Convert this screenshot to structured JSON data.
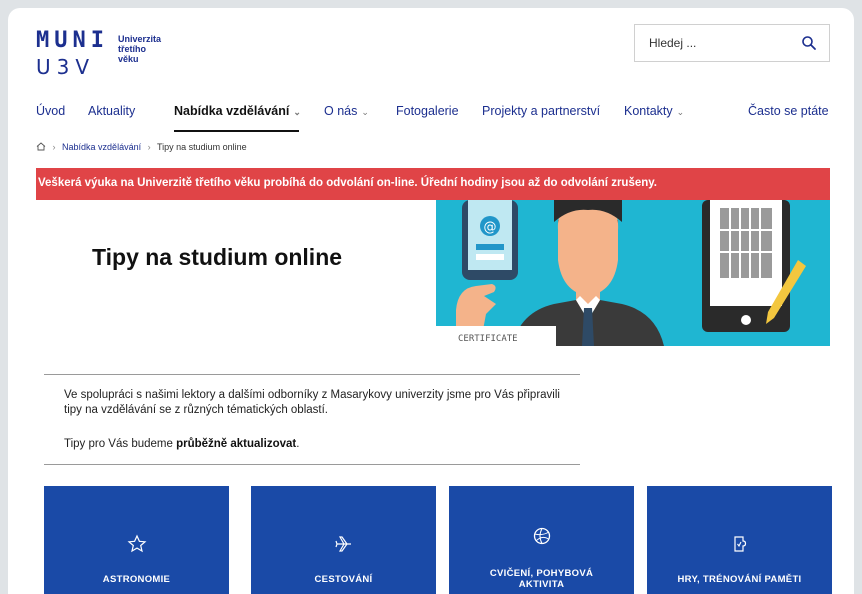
{
  "logo": {
    "mark": "MUNI",
    "sub": "U3V",
    "line1": "Univerzita",
    "line2": "třetího",
    "line3": "věku"
  },
  "search": {
    "placeholder": "Hledej ...",
    "icon": "search-icon"
  },
  "nav": {
    "items": [
      {
        "label": "Úvod"
      },
      {
        "label": "Aktuality"
      },
      {
        "label": "Nabídka vzdělávání",
        "active": true,
        "dropdown": true
      },
      {
        "label": "O nás",
        "dropdown": true
      },
      {
        "label": "Fotogalerie"
      },
      {
        "label": "Projekty a partnerství"
      },
      {
        "label": "Kontakty",
        "dropdown": true
      },
      {
        "label": "Často se ptáte"
      }
    ]
  },
  "breadcrumb": {
    "home_icon": "home-icon",
    "items": [
      "Nabídka vzdělávání",
      "Tipy na studium online"
    ]
  },
  "alert": {
    "text": "Veškerá výuka na Univerzitě třetího věku probíhá do odvolání on-line. Úřední hodiny jsou až do odvolání zrušeny.",
    "color": "#e04447"
  },
  "hero": {
    "title": "Tipy na studium online",
    "image_caption": "CERTIFICATE"
  },
  "intro": {
    "paragraph": "Ve spolupráci s našimi lektory a dalšími odborníky z Masarykovy univerzity jsme pro Vás připravili tipy na vzdělávání se z různých tématických oblastí.",
    "second_prefix": "Tipy pro Vás budeme ",
    "second_bold": "průběžně aktualizovat",
    "second_suffix": "."
  },
  "cards": [
    {
      "label": "ASTRONOMIE",
      "icon": "star-icon"
    },
    {
      "label": "CESTOVÁNÍ",
      "icon": "airplane-icon"
    },
    {
      "label": "CVIČENÍ, POHYBOVÁ AKTIVITA",
      "icon": "ball-icon"
    },
    {
      "label": "HRY, TRÉNOVÁNÍ PAMĚTI",
      "icon": "puzzle-icon"
    }
  ],
  "colors": {
    "brand": "#1c2f8f",
    "card": "#1a4aa7",
    "alert": "#e04447",
    "hero_bg": "#1fb6d2"
  }
}
